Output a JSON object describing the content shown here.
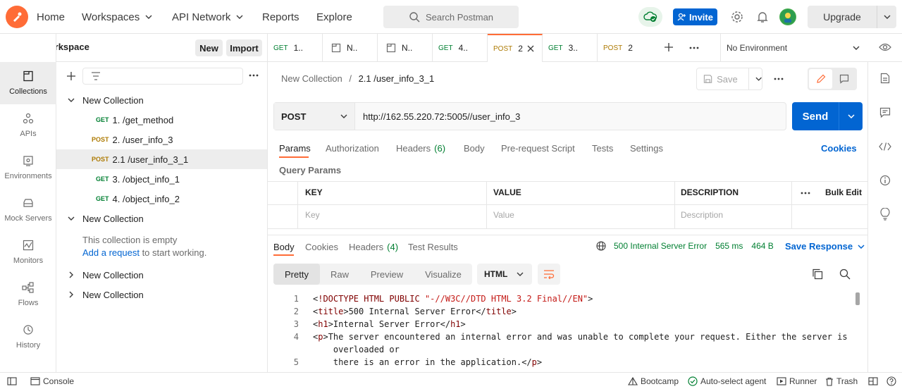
{
  "topbar": {
    "nav": [
      {
        "label": "Home"
      },
      {
        "label": "Workspaces"
      },
      {
        "label": "API Network"
      },
      {
        "label": "Reports"
      },
      {
        "label": "Explore"
      }
    ],
    "search_placeholder": "Search Postman",
    "invite_label": "Invite",
    "upgrade_label": "Upgrade"
  },
  "workspace": {
    "title": "My Workspace",
    "new_label": "New",
    "import_label": "Import"
  },
  "rail": [
    {
      "label": "Collections",
      "icon": "collections-icon"
    },
    {
      "label": "APIs",
      "icon": "apis-icon"
    },
    {
      "label": "Environments",
      "icon": "environments-icon"
    },
    {
      "label": "Mock Servers",
      "icon": "mock-servers-icon"
    },
    {
      "label": "Monitors",
      "icon": "monitors-icon"
    },
    {
      "label": "Flows",
      "icon": "flows-icon"
    },
    {
      "label": "History",
      "icon": "history-icon"
    }
  ],
  "tree": {
    "collection1": "New Collection",
    "requests": [
      {
        "method": "GET",
        "name": "1. /get_method"
      },
      {
        "method": "POST",
        "name": "2. /user_info_3"
      },
      {
        "method": "POST",
        "name": "2.1 /user_info_3_1"
      },
      {
        "method": "GET",
        "name": "3. /object_info_1"
      },
      {
        "method": "GET",
        "name": "4. /object_info_2"
      }
    ],
    "collection2": "New Collection",
    "empty_text": "This collection is empty",
    "empty_link": "Add a request",
    "empty_suffix": " to start working.",
    "collection3": "New Collection",
    "collection4": "New Collection"
  },
  "tabs": [
    {
      "method": "GET",
      "name": "1.."
    },
    {
      "method": "",
      "name": "N.."
    },
    {
      "method": "",
      "name": "N.."
    },
    {
      "method": "GET",
      "name": "4.."
    },
    {
      "method": "POST",
      "name": "2"
    },
    {
      "method": "GET",
      "name": "3.."
    },
    {
      "method": "POST",
      "name": "2"
    }
  ],
  "environment": "No Environment",
  "request": {
    "breadcrumb_parent": "New Collection",
    "breadcrumb_sep": "/",
    "breadcrumb_current": "2.1 /user_info_3_1",
    "save_label": "Save",
    "method": "POST",
    "url": "http://162.55.220.72:5005//user_info_3",
    "send_label": "Send",
    "subtabs": [
      "Params",
      "Authorization",
      "Headers",
      "Body",
      "Pre-request Script",
      "Tests",
      "Settings"
    ],
    "headers_count": "(6)",
    "cookies_label": "Cookies",
    "query_params_label": "Query Params",
    "table": {
      "key": "KEY",
      "value": "VALUE",
      "description": "DESCRIPTION",
      "bulk_edit": "Bulk Edit",
      "key_ph": "Key",
      "value_ph": "Value",
      "description_ph": "Description"
    }
  },
  "response": {
    "tabs": [
      "Body",
      "Cookies",
      "Headers",
      "Test Results"
    ],
    "headers_count": "(4)",
    "status": "500 Internal Server Error",
    "time": "565 ms",
    "size": "464 B",
    "save_label": "Save Response",
    "formats": [
      "Pretty",
      "Raw",
      "Preview",
      "Visualize"
    ],
    "lang": "HTML",
    "lines": [
      {
        "n": "1",
        "parts": [
          [
            "p",
            "<"
          ],
          [
            "t",
            "!DOCTYPE HTML PUBLIC "
          ],
          [
            "s",
            "\"-//W3C//DTD HTML 3.2 Final//EN\""
          ],
          [
            "p",
            ">"
          ]
        ]
      },
      {
        "n": "2",
        "parts": [
          [
            "p",
            "<"
          ],
          [
            "t",
            "title"
          ],
          [
            "p",
            ">500 Internal Server Error</"
          ],
          [
            "t",
            "title"
          ],
          [
            "p",
            ">"
          ]
        ]
      },
      {
        "n": "3",
        "parts": [
          [
            "p",
            "<"
          ],
          [
            "t",
            "h1"
          ],
          [
            "p",
            ">Internal Server Error</"
          ],
          [
            "t",
            "h1"
          ],
          [
            "p",
            ">"
          ]
        ]
      },
      {
        "n": "4",
        "parts": [
          [
            "p",
            "<"
          ],
          [
            "t",
            "p"
          ],
          [
            "p",
            ">The server encountered an internal error and was unable to complete your request. Either the server is"
          ]
        ]
      },
      {
        "n": "",
        "parts": [
          [
            "p",
            "    overloaded or"
          ]
        ]
      },
      {
        "n": "5",
        "parts": [
          [
            "p",
            "    there is an error in the application.</"
          ],
          [
            "t",
            "p"
          ],
          [
            "p",
            ">"
          ]
        ]
      }
    ]
  },
  "footer": {
    "console": "Console",
    "bootcamp": "Bootcamp",
    "agent": "Auto-select agent",
    "runner": "Runner",
    "trash": "Trash"
  },
  "colors": {
    "brand": "#ff6c37",
    "primary": "#0265d2",
    "get": "#007f31",
    "post": "#ad7a03"
  }
}
